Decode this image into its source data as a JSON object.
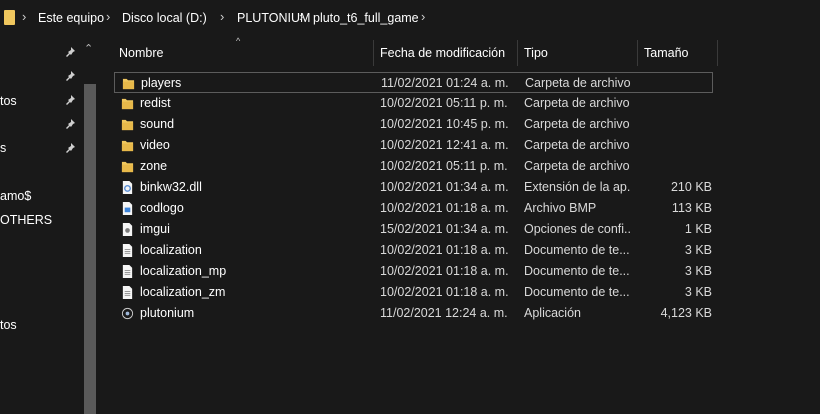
{
  "breadcrumb": [
    "Este equipo",
    "Disco local (D:)",
    "PLUTONIUM",
    "pluto_t6_full_game"
  ],
  "nav_items": [
    "tos",
    "s",
    "amo$",
    "OTHERS",
    "tos"
  ],
  "columns": {
    "name": "Nombre",
    "modified": "Fecha de modificación",
    "type": "Tipo",
    "size": "Tamaño"
  },
  "files": [
    {
      "name": "players",
      "modified": "11/02/2021 01:24 a. m.",
      "type": "Carpeta de archivos",
      "size": "",
      "icon": "folder-icon"
    },
    {
      "name": "redist",
      "modified": "10/02/2021 05:11 p. m.",
      "type": "Carpeta de archivos",
      "size": "",
      "icon": "folder-icon"
    },
    {
      "name": "sound",
      "modified": "10/02/2021 10:45 p. m.",
      "type": "Carpeta de archivos",
      "size": "",
      "icon": "folder-icon"
    },
    {
      "name": "video",
      "modified": "10/02/2021 12:41 a. m.",
      "type": "Carpeta de archivos",
      "size": "",
      "icon": "folder-icon"
    },
    {
      "name": "zone",
      "modified": "10/02/2021 05:11 p. m.",
      "type": "Carpeta de archivos",
      "size": "",
      "icon": "folder-icon"
    },
    {
      "name": "binkw32.dll",
      "modified": "10/02/2021 01:34 a. m.",
      "type": "Extensión de la ap...",
      "size": "210 KB",
      "icon": "dll-icon"
    },
    {
      "name": "codlogo",
      "modified": "10/02/2021 01:18 a. m.",
      "type": "Archivo BMP",
      "size": "113 KB",
      "icon": "bmp-icon"
    },
    {
      "name": "imgui",
      "modified": "15/02/2021 01:34 a. m.",
      "type": "Opciones de confi...",
      "size": "1 KB",
      "icon": "ini-icon"
    },
    {
      "name": "localization",
      "modified": "10/02/2021 01:18 a. m.",
      "type": "Documento de te...",
      "size": "3 KB",
      "icon": "text-document-icon"
    },
    {
      "name": "localization_mp",
      "modified": "10/02/2021 01:18 a. m.",
      "type": "Documento de te...",
      "size": "3 KB",
      "icon": "text-document-icon"
    },
    {
      "name": "localization_zm",
      "modified": "10/02/2021 01:18 a. m.",
      "type": "Documento de te...",
      "size": "3 KB",
      "icon": "text-document-icon"
    },
    {
      "name": "plutonium",
      "modified": "11/02/2021 12:24 a. m.",
      "type": "Aplicación",
      "size": "4,123 KB",
      "icon": "application-icon"
    }
  ],
  "selected_file": "players",
  "colors": {
    "background": "#191919",
    "folder": "#f0c75e",
    "text": "#ffffff",
    "selection_border": "#5c5c5c"
  }
}
